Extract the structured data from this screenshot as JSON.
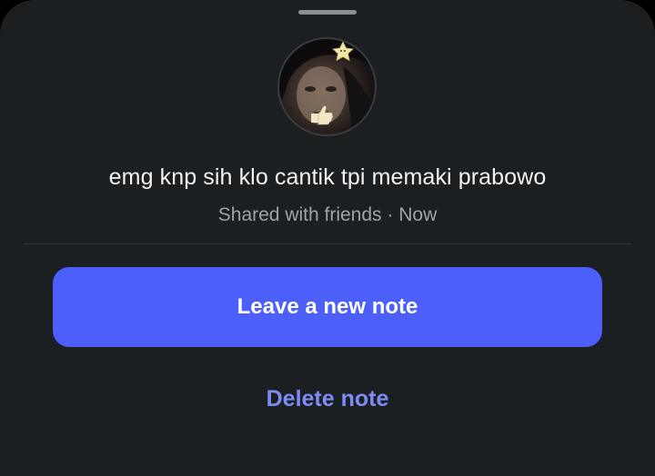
{
  "sheet": {
    "note_text": "emg knp sih klo cantik tpi memaki prabowo",
    "audience": "Shared with friends",
    "separator": "·",
    "time": "Now"
  },
  "actions": {
    "primary_label": "Leave a new note",
    "delete_label": "Delete note"
  },
  "colors": {
    "background": "#1c1f22",
    "primary_button": "#4c5ffb",
    "delete_text": "#7d8cf5",
    "secondary_text": "#9ea3a8"
  },
  "icons": {
    "avatar_stickers": [
      "star-sticker-icon",
      "thumbs-up-sticker-icon"
    ]
  }
}
